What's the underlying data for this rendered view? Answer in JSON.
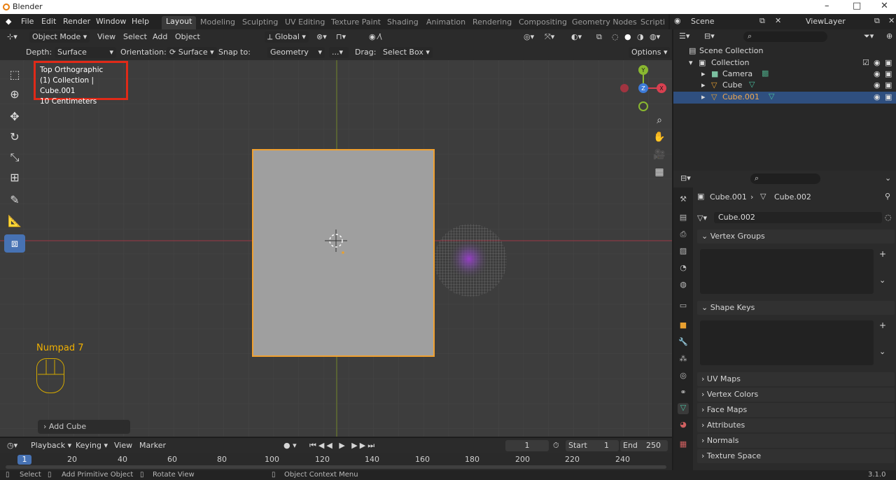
{
  "window": {
    "title": "Blender"
  },
  "menu": [
    "File",
    "Edit",
    "Render",
    "Window",
    "Help"
  ],
  "workspaces": [
    "Layout",
    "Modeling",
    "Sculpting",
    "UV Editing",
    "Texture Paint",
    "Shading",
    "Animation",
    "Rendering",
    "Compositing",
    "Geometry Nodes",
    "Scripti"
  ],
  "scene": {
    "label": "Scene",
    "view_layer": "ViewLayer"
  },
  "viewport_header": {
    "mode": "Object Mode",
    "view": "View",
    "select": "Select",
    "add": "Add",
    "object": "Object",
    "orientation_global": "Global"
  },
  "tool_settings": {
    "depth_label": "Depth:",
    "depth_value": "Surface",
    "orientation_label": "Orientation:",
    "orientation_value": "Surface",
    "snap_label": "Snap to:",
    "snap_value": "Geometry",
    "snap_more": "...",
    "drag_label": "Drag:",
    "drag_value": "Select Box",
    "options": "Options"
  },
  "viewport_info": {
    "line1": "Top Orthographic",
    "line2": "(1) Collection | Cube.001",
    "line3": "10 Centimeters"
  },
  "gizmo": {
    "y": "Y",
    "z": "Z",
    "x": "X"
  },
  "hint": {
    "key": "Numpad 7"
  },
  "last_op": "Add Cube",
  "timeline": {
    "playback": "Playback",
    "keying": "Keying",
    "view": "View",
    "marker": "Marker",
    "current": "1",
    "start_label": "Start",
    "start": "1",
    "end_label": "End",
    "end": "250",
    "ticks": [
      "1",
      "20",
      "40",
      "60",
      "80",
      "100",
      "120",
      "140",
      "160",
      "180",
      "200",
      "220",
      "240"
    ]
  },
  "outliner": {
    "root": "Scene Collection",
    "items": [
      {
        "label": "Collection"
      },
      {
        "label": "Camera"
      },
      {
        "label": "Cube"
      },
      {
        "label": "Cube.001"
      }
    ]
  },
  "properties": {
    "object": "Cube.001",
    "mesh": "Cube.002",
    "datablock": "Cube.002",
    "panels": [
      "Vertex Groups",
      "Shape Keys",
      "UV Maps",
      "Vertex Colors",
      "Face Maps",
      "Attributes",
      "Normals",
      "Texture Space"
    ]
  },
  "status": {
    "select": "Select",
    "add_primitive": "Add Primitive Object",
    "rotate": "Rotate View",
    "context": "Object Context Menu",
    "version": "3.1.0"
  }
}
